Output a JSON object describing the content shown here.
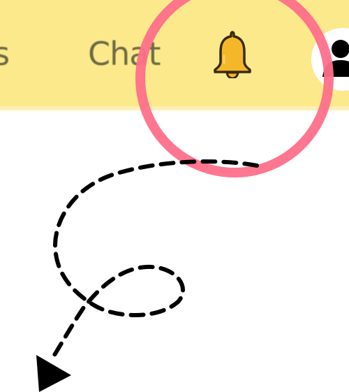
{
  "nav": {
    "items": [
      {
        "label": "ings"
      },
      {
        "label": "Chat"
      }
    ]
  },
  "icons": {
    "bell": "bell-icon",
    "avatar": "user-avatar-icon"
  },
  "annotation": {
    "highlight_color": "#ff6f8a",
    "arrow_color": "#000000"
  },
  "colors": {
    "header_bg": "#fbe98c",
    "bell_fill": "#f5b72a",
    "nav_text": "#6d6a45"
  }
}
